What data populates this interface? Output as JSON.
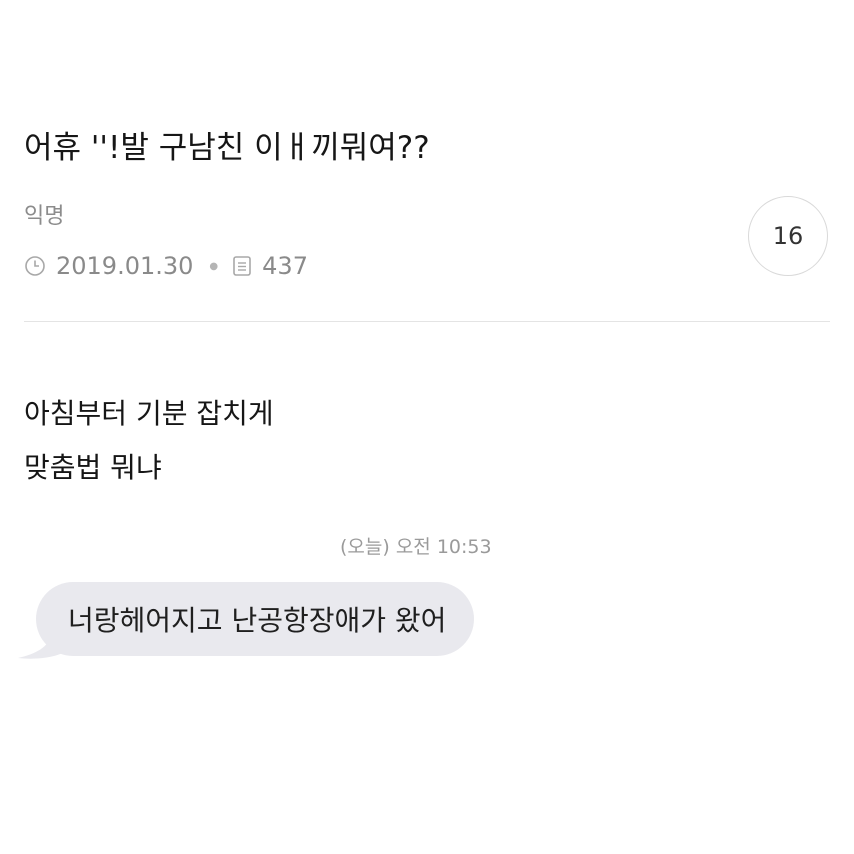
{
  "post": {
    "title": "어휴 ''!발 구남친 이ㅐ끼뭐여??",
    "author": "익명",
    "date": "2019.01.30",
    "views": "437",
    "comment_count": "16",
    "body_lines": [
      "아침부터 기분 잡치게",
      "맞춤법 뭐냐"
    ]
  },
  "chat": {
    "timestamp": "(오늘) 오전 10:53",
    "message": "너랑헤어지고 난공항장애가 왔어",
    "bubble_color": "#e9e9ee"
  },
  "icons": {
    "date": "clock-icon",
    "views": "document-icon"
  }
}
